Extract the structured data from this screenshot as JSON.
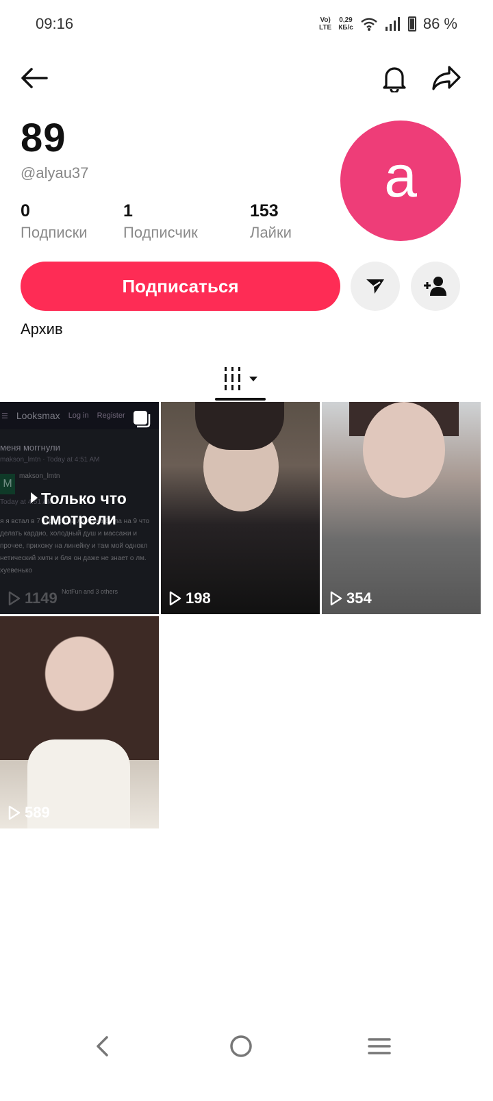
{
  "status_bar": {
    "time": "09:16",
    "network_top": "Vo)",
    "network_bottom": "LTE",
    "speed_top": "0,29",
    "speed_bottom": "КБ/с",
    "battery": "86 %"
  },
  "profile": {
    "display_name": "89",
    "username": "@alyau37",
    "avatar_letter": "a",
    "avatar_color": "#ee3d78",
    "stats": [
      {
        "value": "0",
        "label": "Подписки"
      },
      {
        "value": "1",
        "label": "Подписчик"
      },
      {
        "value": "153",
        "label": "Лайки"
      }
    ],
    "follow_label": "Подписаться",
    "accent_color": "#fe2c55",
    "archive_label": "Архив"
  },
  "videos": [
    {
      "views": "1149",
      "overlay_label_line1": "Только что",
      "overlay_label_line2": "смотрели",
      "header_brand": "Looksmax",
      "header_login": "Log in",
      "header_register": "Register",
      "post_title": "меня моггнули",
      "post_meta": "makson_lmtn · Today at 4:51 AM",
      "post_author": "makson_lmtn",
      "post_avatar_letter": "M",
      "post_time": "Today at 4:51 AM",
      "body_lines": [
        "я я встал в 7 утра когда линейка была на 9 что",
        "делать кардио, холодный душ и массажи и",
        "прочее, прихожу на линейку и там мой однокл",
        "нетический хмтн и бля он даже не знает о лм.",
        "хуевенько"
      ],
      "reactions": "NotFun and 3 others"
    },
    {
      "views": "198"
    },
    {
      "views": "354"
    },
    {
      "views": "589"
    }
  ]
}
